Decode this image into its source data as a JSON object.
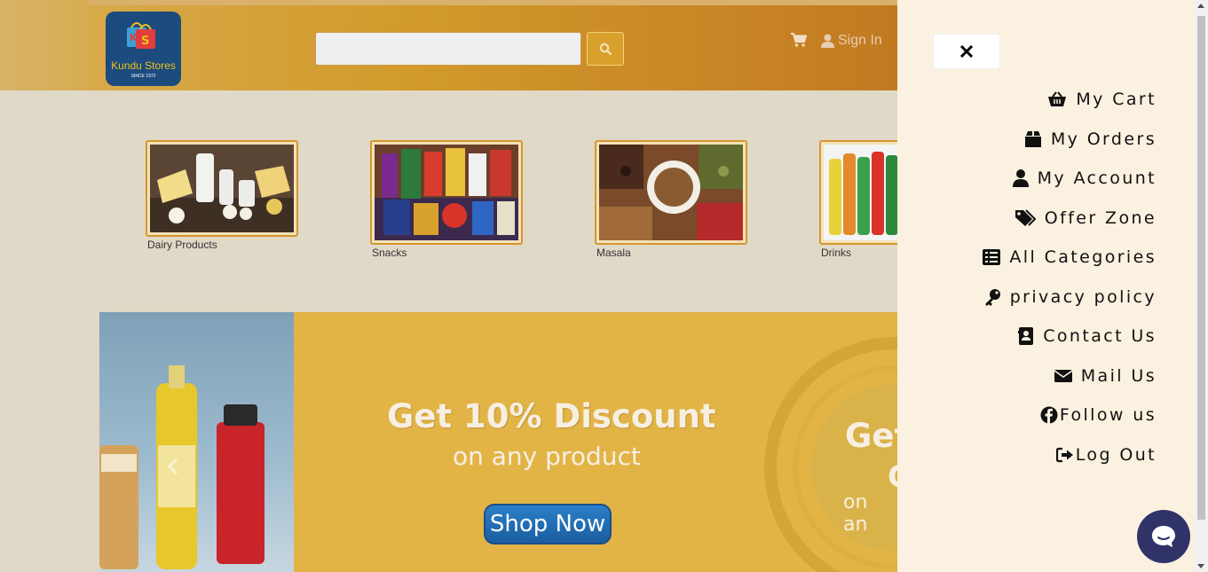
{
  "header": {
    "logo": {
      "brand": "Kundu Stores",
      "since": "SINCE 1972"
    },
    "search": {
      "value": "",
      "placeholder": ""
    },
    "signin_label": "Sign In"
  },
  "categories": [
    {
      "label": "Dairy Products",
      "icon": "dairy-image"
    },
    {
      "label": "Snacks",
      "icon": "snacks-image"
    },
    {
      "label": "Masala",
      "icon": "masala-image"
    },
    {
      "label": "Drinks",
      "icon": "drinks-image"
    }
  ],
  "banner": {
    "title": "Get 10% Discount",
    "subtitle": "on any product",
    "cta": "Shop Now",
    "partial_title": "Get",
    "partial_letter": "C",
    "partial_sub": "on an"
  },
  "drawer": {
    "close_label": "×",
    "items": [
      {
        "label": "My Cart",
        "icon": "basket-icon"
      },
      {
        "label": "My Orders",
        "icon": "box-icon"
      },
      {
        "label": "My Account",
        "icon": "user-icon"
      },
      {
        "label": "Offer Zone",
        "icon": "tags-icon"
      },
      {
        "label": "All Categories",
        "icon": "list-icon"
      },
      {
        "label": "privacy policy",
        "icon": "key-icon"
      },
      {
        "label": "Contact Us",
        "icon": "address-book-icon"
      },
      {
        "label": "Mail Us",
        "icon": "envelope-icon"
      },
      {
        "label": "Follow us",
        "icon": "facebook-icon"
      },
      {
        "label": "Log Out",
        "icon": "sign-out-icon"
      }
    ]
  },
  "colors": {
    "header_gradient_start": "#d8a94a",
    "header_gradient_end": "#c27a20",
    "drawer_bg": "#faf1e0",
    "banner_bg": "#e2b446",
    "shop_button": "#2b7fc8",
    "chat_bubble": "#2f3367"
  }
}
